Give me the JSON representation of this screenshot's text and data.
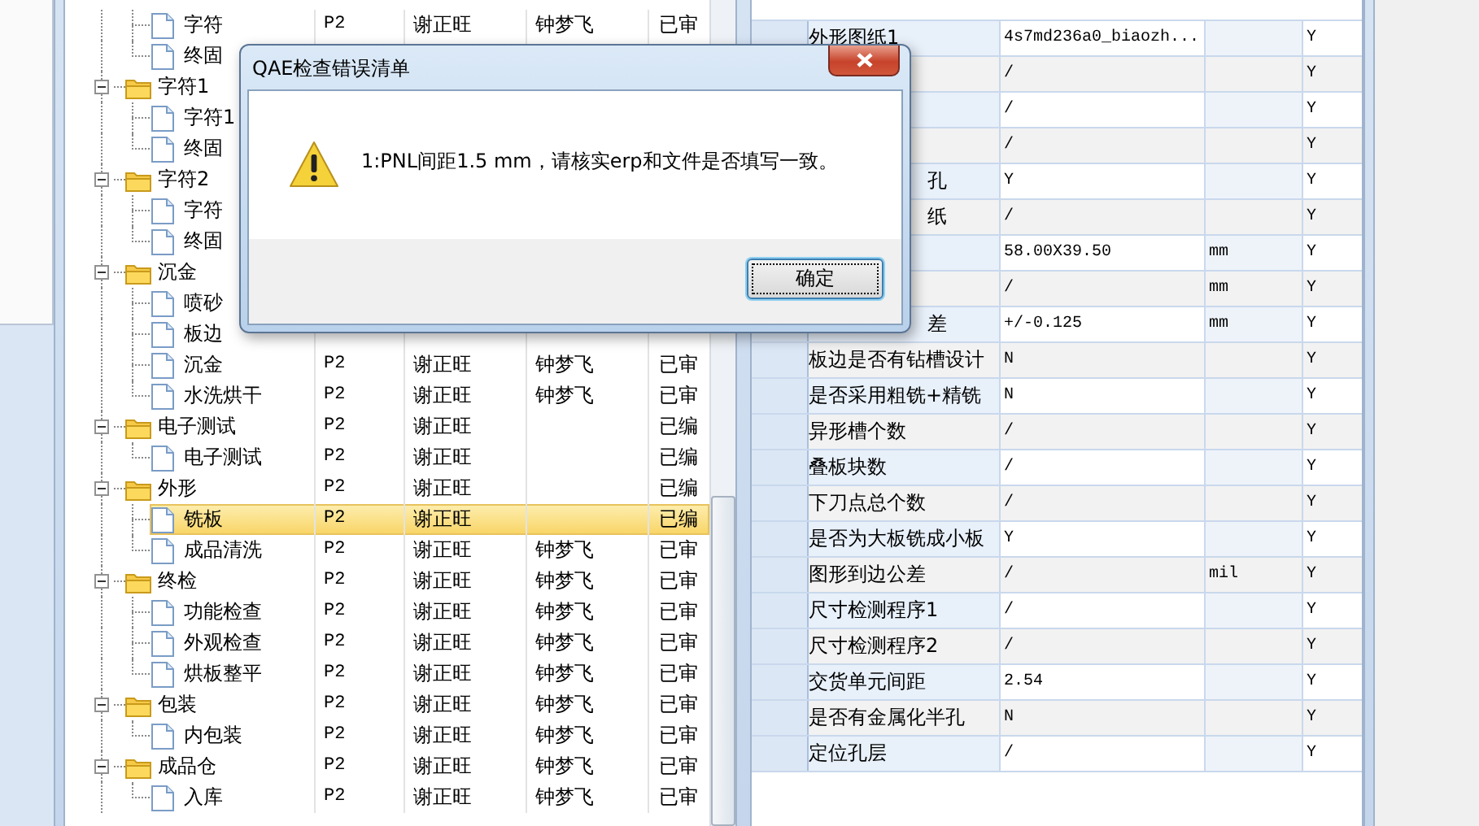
{
  "tree": [
    {
      "children": [
        {
          "label": "字符",
          "selected": false,
          "column_2": "P2",
          "column_3": "谢正旺",
          "column_4": "钟梦飞",
          "column_5": "已审"
        },
        {
          "label": "终固",
          "selected": false
        }
      ]
    },
    {
      "label": "字符1",
      "expanded": true,
      "selected": false,
      "children": [
        {
          "label": "字符1",
          "selected": false
        },
        {
          "label": "终固",
          "selected": false
        }
      ]
    },
    {
      "label": "字符2",
      "expanded": true,
      "selected": false,
      "children": [
        {
          "label": "字符",
          "selected": false
        },
        {
          "label": "终固",
          "selected": false
        }
      ]
    },
    {
      "label": "沉金",
      "expanded": true,
      "selected": false,
      "children": [
        {
          "label": "喷砂",
          "selected": false
        },
        {
          "label": "板边",
          "selected": false
        },
        {
          "label": "沉金",
          "selected": false,
          "column_2": "P2",
          "column_3": "谢正旺",
          "column_4": "钟梦飞",
          "column_5": "已审"
        },
        {
          "label": "水洗烘干",
          "selected": false,
          "column_2": "P2",
          "column_3": "谢正旺",
          "column_4": "钟梦飞",
          "column_5": "已审"
        }
      ]
    },
    {
      "label": "电子测试",
      "expanded": true,
      "selected": false,
      "column_2": "P2",
      "column_3": "谢正旺",
      "column_5": "已编",
      "children": [
        {
          "label": "电子测试",
          "selected": false,
          "column_2": "P2",
          "column_3": "谢正旺",
          "column_5": "已编"
        }
      ]
    },
    {
      "label": "外形",
      "expanded": true,
      "selected": false,
      "column_2": "P2",
      "column_3": "谢正旺",
      "column_5": "已编",
      "children": [
        {
          "label": "铣板",
          "selected": true,
          "column_2": "P2",
          "column_3": "谢正旺",
          "column_5": "已编"
        },
        {
          "label": "成品清洗",
          "selected": false,
          "column_2": "P2",
          "column_3": "谢正旺",
          "column_4": "钟梦飞",
          "column_5": "已审"
        }
      ]
    },
    {
      "label": "终检",
      "expanded": true,
      "selected": false,
      "column_2": "P2",
      "column_3": "谢正旺",
      "column_4": "钟梦飞",
      "column_5": "已审",
      "children": [
        {
          "label": "功能检查",
          "selected": false,
          "column_2": "P2",
          "column_3": "谢正旺",
          "column_4": "钟梦飞",
          "column_5": "已审"
        },
        {
          "label": "外观检查",
          "selected": false,
          "column_2": "P2",
          "column_3": "谢正旺",
          "column_4": "钟梦飞",
          "column_5": "已审"
        },
        {
          "label": "烘板整平",
          "selected": false,
          "column_2": "P2",
          "column_3": "谢正旺",
          "column_4": "钟梦飞",
          "column_5": "已审"
        }
      ]
    },
    {
      "label": "包装",
      "expanded": true,
      "selected": false,
      "column_2": "P2",
      "column_3": "谢正旺",
      "column_4": "钟梦飞",
      "column_5": "已审",
      "children": [
        {
          "label": "内包装",
          "selected": false,
          "column_2": "P2",
          "column_3": "谢正旺",
          "column_4": "钟梦飞",
          "column_5": "已审"
        }
      ]
    },
    {
      "label": "成品仓",
      "expanded": true,
      "selected": false,
      "column_2": "P2",
      "column_3": "谢正旺",
      "column_4": "钟梦飞",
      "column_5": "已审",
      "children": [
        {
          "label": "入库",
          "selected": false,
          "column_2": "P2",
          "column_3": "谢正旺",
          "column_4": "钟梦飞",
          "column_5": "已审"
        }
      ]
    }
  ],
  "grid": {
    "rows": [
      {
        "kind": "plain",
        "column_1": "外形图纸1",
        "column_2": "4s7md236a0_biaozh...",
        "column_4": "Y"
      },
      {
        "kind": "plain",
        "column_2": "/",
        "column_4": "Y"
      },
      {
        "kind": "plain",
        "column_2": "/",
        "column_4": "Y"
      },
      {
        "kind": "plain",
        "column_2": "/",
        "column_4": "Y"
      },
      {
        "kind": "clipped",
        "column_1": "孔",
        "column_2": "Y",
        "column_4": "Y"
      },
      {
        "kind": "clipped",
        "column_1": "纸",
        "column_2": "/",
        "column_4": "Y"
      },
      {
        "kind": "plain",
        "column_2": "58.00X39.50",
        "column_3": "mm",
        "column_4": "Y"
      },
      {
        "kind": "plain",
        "column_2": "/",
        "column_3": "mm",
        "column_4": "Y"
      },
      {
        "kind": "clipped",
        "column_1": "差",
        "column_2": "+/-0.125",
        "column_3": "mm",
        "column_4": "Y"
      },
      {
        "kind": "plain",
        "column_1": "板边是否有钻槽设计",
        "column_2": "N",
        "column_4": "Y"
      },
      {
        "kind": "plain",
        "column_1": "是否采用粗铣+精铣",
        "column_2": "N",
        "column_4": "Y"
      },
      {
        "kind": "plain",
        "column_1": "异形槽个数",
        "column_2": "/",
        "column_4": "Y"
      },
      {
        "kind": "plain",
        "column_1": "叠板块数",
        "column_2": "/",
        "column_4": "Y"
      },
      {
        "kind": "plain",
        "column_1": "下刀点总个数",
        "column_2": "/",
        "column_4": "Y"
      },
      {
        "kind": "plain",
        "column_1": "是否为大板铣成小板",
        "column_2": "Y",
        "column_4": "Y"
      },
      {
        "kind": "plain",
        "column_1": "图形到边公差",
        "column_2": "/",
        "column_3": "mil",
        "column_4": "Y"
      },
      {
        "kind": "plain",
        "column_1": "尺寸检测程序1",
        "column_2": "/",
        "column_4": "Y"
      },
      {
        "kind": "plain",
        "column_1": "尺寸检测程序2",
        "column_2": "/",
        "column_4": "Y"
      },
      {
        "kind": "plain",
        "column_1": "交货单元间距",
        "column_2": "2.54",
        "column_4": "Y"
      },
      {
        "kind": "plain",
        "column_1": "是否有金属化半孔",
        "column_2": "N",
        "column_4": "Y"
      },
      {
        "kind": "plain",
        "column_1": "定位孔层",
        "column_2": "/",
        "column_4": "Y"
      }
    ]
  },
  "dialog": {
    "title": "QAE检查错误清单",
    "message": "1:PNL间距1.5 mm，请核实erp和文件是否填写一致。",
    "buttons": [
      {
        "label": "确定",
        "focused": true
      }
    ]
  }
}
